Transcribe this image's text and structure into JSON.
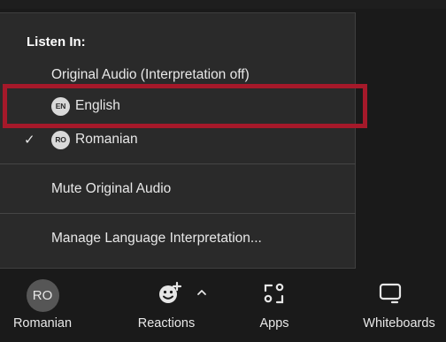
{
  "menu": {
    "header": "Listen In:",
    "items": [
      {
        "label": "Original Audio (Interpretation off)"
      },
      {
        "label": "English",
        "badge": "EN",
        "selected": false
      },
      {
        "label": "Romanian",
        "badge": "RO",
        "selected": true
      }
    ],
    "mute_label": "Mute Original Audio",
    "manage_label": "Manage Language Interpretation...",
    "check_glyph": "✓"
  },
  "toolbar": {
    "interpretation": {
      "avatar_text": "RO",
      "label": "Romanian"
    },
    "reactions": {
      "label": "Reactions",
      "icon": "smiley-plus-icon"
    },
    "apps": {
      "label": "Apps",
      "icon": "apps-icon"
    },
    "whiteboards": {
      "label": "Whiteboards",
      "icon": "whiteboard-icon"
    }
  },
  "colors": {
    "menu_bg": "#2a2a2a",
    "highlight_border": "#a5192a",
    "toolbar_bg": "#1a1a1a",
    "text": "#e8e8e8"
  }
}
